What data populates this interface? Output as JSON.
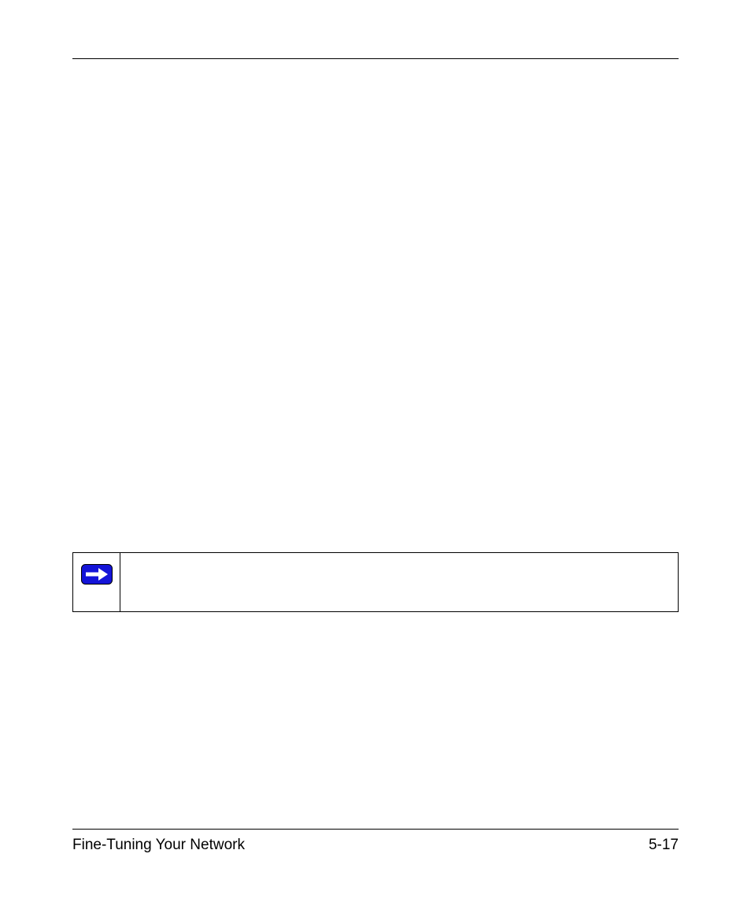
{
  "footer": {
    "left": "Fine-Tuning Your Network",
    "right": "5-17"
  },
  "icons": {
    "note_arrow": "note-arrow-icon"
  }
}
